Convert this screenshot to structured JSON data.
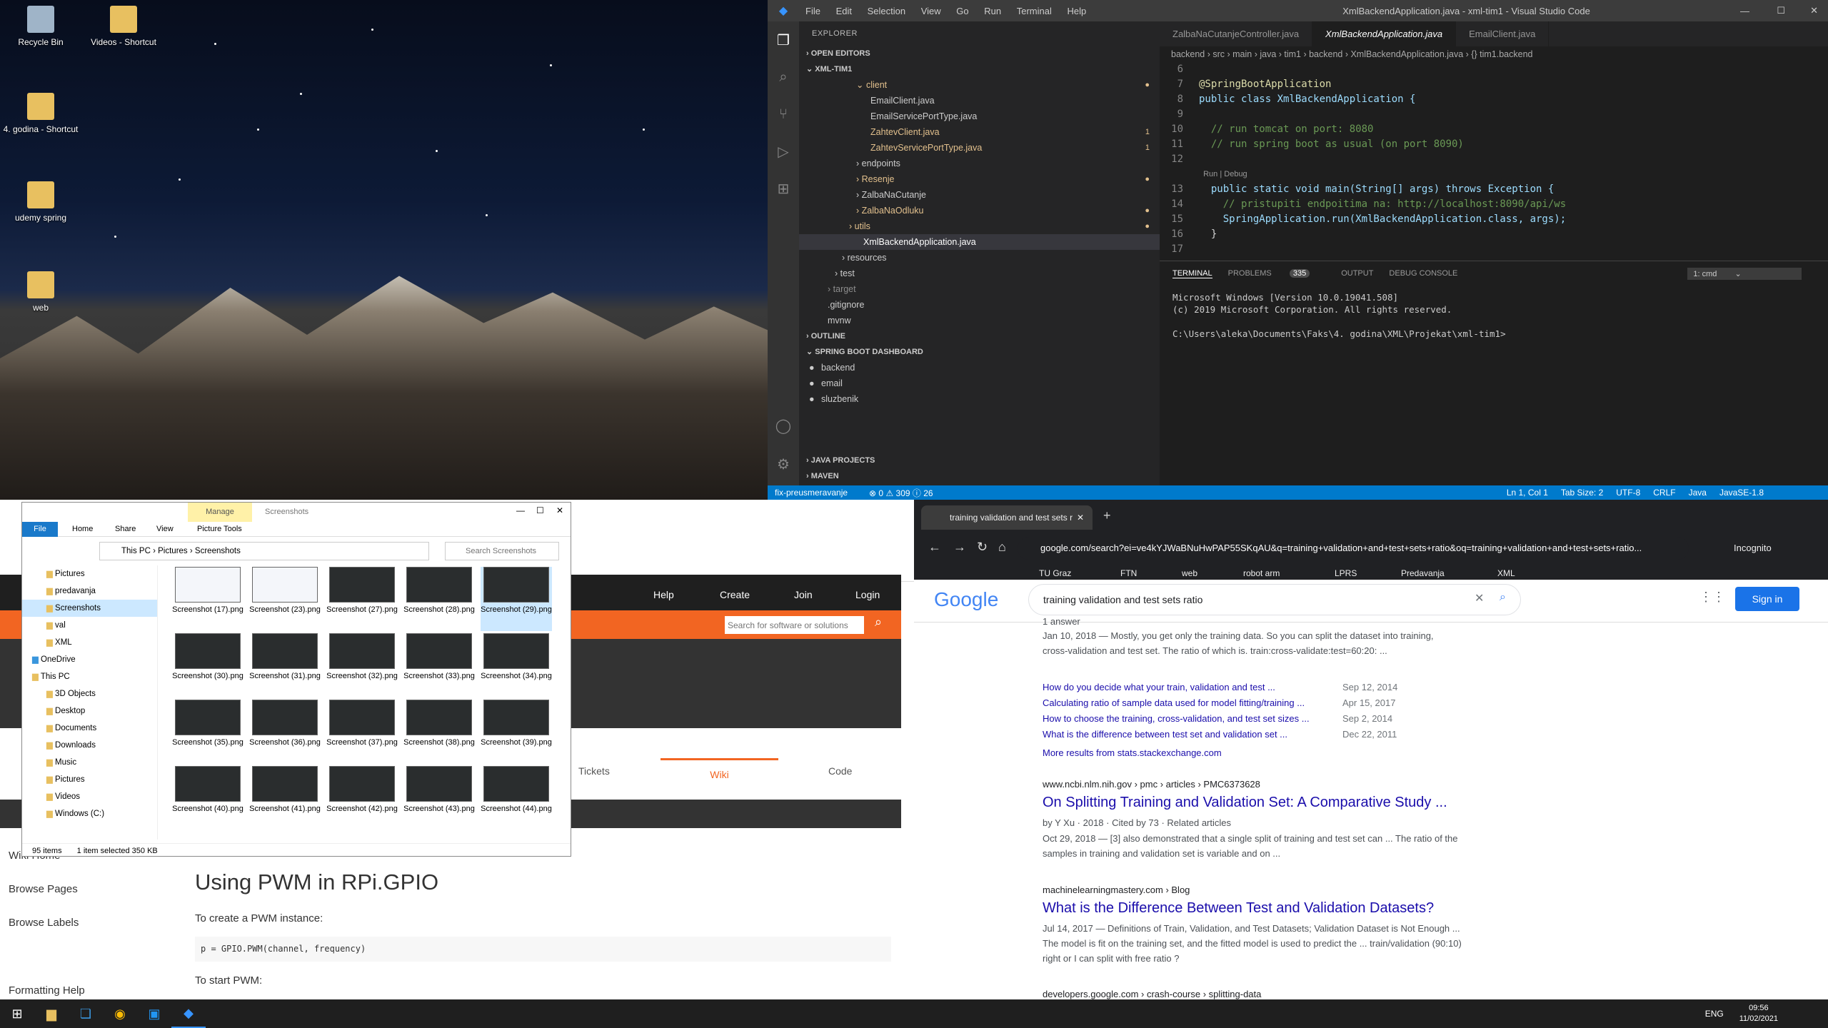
{
  "desktop": {
    "icons": [
      {
        "label": "Recycle Bin"
      },
      {
        "label": "Videos - Shortcut"
      },
      {
        "label": "4. godina - Shortcut"
      },
      {
        "label": "udemy spring"
      },
      {
        "label": "web"
      }
    ]
  },
  "vscode": {
    "title": "XmlBackendApplication.java - xml-tim1 - Visual Studio Code",
    "menu": [
      "File",
      "Edit",
      "Selection",
      "View",
      "Go",
      "Run",
      "Terminal",
      "Help"
    ],
    "explorer_header": "EXPLORER",
    "open_editors": "OPEN EDITORS",
    "workspace": "XML-TIM1",
    "tree": [
      {
        "label": "client",
        "indent": 2,
        "type": "folder-open",
        "color": "#e2c08d",
        "badge": "●"
      },
      {
        "label": "EmailClient.java",
        "indent": 4,
        "type": "file",
        "color": "#cccccc",
        "badge": ""
      },
      {
        "label": "EmailServicePortType.java",
        "indent": 4,
        "type": "file",
        "color": "#cccccc",
        "badge": ""
      },
      {
        "label": "ZahtevClient.java",
        "indent": 4,
        "type": "file",
        "color": "#e2c08d",
        "badge": "1"
      },
      {
        "label": "ZahtevServicePortType.java",
        "indent": 4,
        "type": "file",
        "color": "#e2c08d",
        "badge": "1"
      },
      {
        "label": "endpoints",
        "indent": 2,
        "type": "folder",
        "color": "#cccccc",
        "badge": ""
      },
      {
        "label": "Resenje",
        "indent": 2,
        "type": "folder",
        "color": "#e2c08d",
        "badge": "●"
      },
      {
        "label": "ZalbaNaCutanje",
        "indent": 2,
        "type": "folder",
        "color": "#cccccc",
        "badge": ""
      },
      {
        "label": "ZalbaNaOdluku",
        "indent": 2,
        "type": "folder",
        "color": "#e2c08d",
        "badge": "●"
      },
      {
        "label": "utils",
        "indent": 1,
        "type": "folder",
        "color": "#e2c08d",
        "badge": "●"
      },
      {
        "label": "XmlBackendApplication.java",
        "indent": 3,
        "type": "file-selected",
        "color": "#ffffff",
        "badge": ""
      },
      {
        "label": "resources",
        "indent": 0,
        "type": "folder",
        "color": "#cccccc",
        "badge": ""
      },
      {
        "label": "test",
        "indent": -1,
        "type": "folder",
        "color": "#cccccc",
        "badge": ""
      },
      {
        "label": "target",
        "indent": -2,
        "type": "folder",
        "color": "#8c8c8c",
        "badge": ""
      },
      {
        "label": ".gitignore",
        "indent": -2,
        "type": "file",
        "color": "#cccccc",
        "badge": ""
      },
      {
        "label": "mvnw",
        "indent": -2,
        "type": "file",
        "color": "#cccccc",
        "badge": ""
      }
    ],
    "outline": "OUTLINE",
    "spring_dashboard": "SPRING BOOT DASHBOARD",
    "spring_items": [
      "backend",
      "email",
      "sluzbenik"
    ],
    "java_projects": "JAVA PROJECTS",
    "maven": "MAVEN",
    "tabs": [
      "ZalbaNaCutanjeController.java",
      "XmlBackendApplication.java",
      "EmailClient.java"
    ],
    "breadcrumb": "backend › src › main › java › tim1 › backend › XmlBackendApplication.java › {} tim1.backend",
    "code_lines": [
      {
        "n": "6",
        "text": ""
      },
      {
        "n": "7",
        "text": "@SpringBootApplication"
      },
      {
        "n": "8",
        "text": "public class XmlBackendApplication {"
      },
      {
        "n": "9",
        "text": ""
      },
      {
        "n": "10",
        "text": "  // run tomcat on port: 8080"
      },
      {
        "n": "11",
        "text": "  // run spring boot as usual (on port 8090)"
      },
      {
        "n": "12",
        "text": ""
      },
      {
        "n": "",
        "text": "  Run | Debug"
      },
      {
        "n": "13",
        "text": "  public static void main(String[] args) throws Exception {"
      },
      {
        "n": "14",
        "text": "    // pristupiti endpoitima na: http://localhost:8090/api/ws"
      },
      {
        "n": "15",
        "text": "    SpringApplication.run(XmlBackendApplication.class, args);"
      },
      {
        "n": "16",
        "text": "  }"
      },
      {
        "n": "17",
        "text": ""
      }
    ],
    "terminal_tabs": [
      "TERMINAL",
      "PROBLEMS",
      "OUTPUT",
      "DEBUG CONSOLE"
    ],
    "problems_count": "335",
    "terminal_select": "1: cmd",
    "terminal_text": "Microsoft Windows [Version 10.0.19041.508]\n(c) 2019 Microsoft Corporation. All rights reserved.\n\nC:\\Users\\aleka\\Documents\\Faks\\4. godina\\XML\\Projekat\\xml-tim1>",
    "status_left": [
      "fix-preusmeravanje",
      "⊗ 0 ⚠ 309 ⓘ 26"
    ],
    "status_right": [
      "Ln 1, Col 1",
      "Tab Size: 2",
      "UTF-8",
      "CRLF",
      "Java",
      "JavaSE-1.8"
    ]
  },
  "explorer": {
    "manage_tab": "Manage",
    "title": "Screenshots",
    "ribbon_tabs": [
      "File",
      "Home",
      "Share",
      "View",
      "Picture Tools"
    ],
    "path": [
      "This PC",
      "Pictures",
      "Screenshots"
    ],
    "search_placeholder": "Search Screenshots",
    "nav_items": [
      "Pictures",
      "predavanja",
      "Screenshots",
      "val",
      "XML",
      "OneDrive",
      "This PC",
      "3D Objects",
      "Desktop",
      "Documents",
      "Downloads",
      "Music",
      "Pictures",
      "Videos",
      "Windows (C:)"
    ],
    "thumbs": [
      "Screenshot (17).png",
      "Screenshot (23).png",
      "Screenshot (27).png",
      "Screenshot (28).png",
      "Screenshot (29).png",
      "Screenshot (30).png",
      "Screenshot (31).png",
      "Screenshot (32).png",
      "Screenshot (33).png",
      "Screenshot (34).png",
      "Screenshot (35).png",
      "Screenshot (36).png",
      "Screenshot (37).png",
      "Screenshot (38).png",
      "Screenshot (39).png",
      "Screenshot (40).png",
      "Screenshot (41).png",
      "Screenshot (42).png",
      "Screenshot (43).png",
      "Screenshot (44).png"
    ],
    "selected_thumb": "Screenshot (29).png",
    "status_count": "95 items",
    "status_selected": "1 item selected  350 KB"
  },
  "wiki": {
    "nav_links": [
      "Help",
      "Create",
      "Join",
      "Login"
    ],
    "search_placeholder": "Search for software or solutions",
    "tabs": [
      "Tickets",
      "Wiki",
      "Code"
    ],
    "sidebar": [
      "Wiki Home",
      "Browse Pages",
      "Browse Labels",
      "Formatting Help"
    ],
    "heading": "Using PWM in RPi.GPIO",
    "intro": "To create a PWM instance:",
    "code": "p = GPIO.PWM(channel, frequency)",
    "start": "To start PWM:"
  },
  "chrome": {
    "tab_title": "training validation and test sets r",
    "url": "google.com/search?ei=ve4kYJWaBNuHwPAP55SKqAU&q=training+validation+and+test+sets+ratio&oq=training+validation+and+test+sets+ratio...",
    "incognito": "Incognito",
    "bookmarks": [
      "TU Graz",
      "FTN",
      "web",
      "robot arm",
      "LPRS",
      "Predavanja",
      "XML"
    ],
    "query": "training validation and test sets ratio",
    "sign_in": "Sign in",
    "top_snippet_meta": "1 answer",
    "top_snippet": "Jan 10, 2018 — Mostly, you get only the training data. So you can split the dataset into training, cross-validation and test set. The ratio of which is. train:cross-validate:test=60:20: ...",
    "related": [
      {
        "q": "How do you decide what your train, validation and test ...",
        "d": "Sep 12, 2014"
      },
      {
        "q": "Calculating ratio of sample data used for model fitting/training ...",
        "d": "Apr 15, 2017"
      },
      {
        "q": "How to choose the training, cross-validation, and test set sizes ...",
        "d": "Sep 2, 2014"
      },
      {
        "q": "What is the difference between test set and validation set ...",
        "d": "Dec 22, 2011"
      }
    ],
    "more_results": "More results from stats.stackexchange.com",
    "result1_url": "www.ncbi.nlm.nih.gov › pmc › articles › PMC6373628",
    "result1_title": "On Splitting Training and Validation Set: A Comparative Study ...",
    "result1_meta": "by Y Xu · 2018 · Cited by 73 · Related articles",
    "result1_snip": "Oct 29, 2018 — [3] also demonstrated that a single split of training and test set can ... The ratio of the samples in training and validation set is variable and on ...",
    "result2_url": "machinelearningmastery.com › Blog",
    "result2_title": "What is the Difference Between Test and Validation Datasets?",
    "result2_snip": "Jul 14, 2017 — Definitions of Train, Validation, and Test Datasets; Validation Dataset is Not Enough ... The model is fit on the training set, and the fitted model is used to predict the ... train/validation (90:10) right or I can split with free ratio ?",
    "result3_url": "developers.google.com › crash-course › splitting-data"
  },
  "taskbar": {
    "lang": "ENG",
    "time": "09:56",
    "date": "11/02/2021"
  }
}
